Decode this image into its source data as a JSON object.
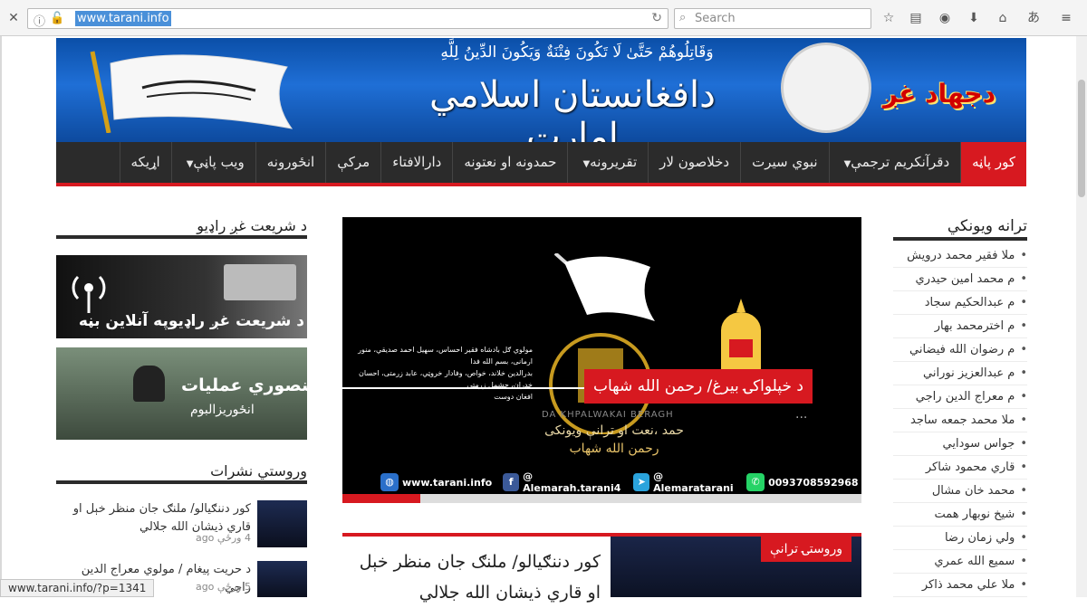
{
  "browser": {
    "url": "www.tarani.info",
    "search_placeholder": "Search",
    "status_url": "www.tarani.info/?p=1341"
  },
  "banner": {
    "verse": "وَقَاتِلُوهُمْ حَتَّىٰ لَا تَكُونَ فِتْنَةٌ وَيَكُونَ الدِّينُ لِلَّهِ",
    "title": "دافغانستان اسلامي امارت",
    "brand": "دجهاد غږ"
  },
  "nav": [
    {
      "label": "کور پاڼه",
      "active": true,
      "caret": false
    },
    {
      "label": "دقرآنکریم ترجمې",
      "active": false,
      "caret": true
    },
    {
      "label": "نبوي سيرت",
      "active": false,
      "caret": false
    },
    {
      "label": "دخلاصون لار",
      "active": false,
      "caret": false
    },
    {
      "label": "تقريرونه",
      "active": false,
      "caret": true
    },
    {
      "label": "حمدونه او نعتونه",
      "active": false,
      "caret": false
    },
    {
      "label": "دارالافتاء",
      "active": false,
      "caret": false
    },
    {
      "label": "مرکې",
      "active": false,
      "caret": false
    },
    {
      "label": "انځورونه",
      "active": false,
      "caret": false
    },
    {
      "label": "ويب پاڼې",
      "active": false,
      "caret": true
    },
    {
      "label": "اړيکه",
      "active": false,
      "caret": false
    }
  ],
  "right_sidebar": {
    "title": "ترانه ويونکي",
    "songs": [
      "ملا فقير محمد درويش",
      "م محمد امين حيدري",
      "م عبدالحکيم سجاد",
      "م اخترمحمد بهار",
      "م رضوان الله فيضاني",
      "م عبدالعزيز نوراني",
      "م معراج الدين راجي",
      "ملا محمد جمعه ساجد",
      "جواس سودايي",
      "قاري محمود شاکر",
      "محمد خان مشال",
      "شيخ نوبهار همت",
      "ولي زمان رضا",
      "سميع الله عمري",
      "ملا علي محمد ذاکر"
    ]
  },
  "slider": {
    "caption": "د خپلواکۍ بیرغ/ رحمن الله شهاب",
    "ellipsis": "...",
    "watermark": "DA KHPALWAKAI BERAGH",
    "subtitle_line1": "حمد ،نعت او ترانې ويونکی",
    "subtitle_line2": "رحمن الله شهاب",
    "contacts": [
      {
        "icon": "globe-icon",
        "text": "www.tarani.info"
      },
      {
        "icon": "facebook-icon",
        "text": "@ Alemarah.tarani4"
      },
      {
        "icon": "telegram-icon",
        "text": "@ Alemaratarani"
      },
      {
        "icon": "whatsapp-icon",
        "text": "0093708592968"
      }
    ]
  },
  "latest_song": {
    "tag": "وروستۍ ترانې",
    "title": "کور دننګيالو/ ملنګ جان منظر خېل او قاري ذيشان الله جلالي"
  },
  "left_sidebar": {
    "radio_title": "د شريعت غږ راډيو",
    "radio_banner_text": "د شريعت غږ راډيوپه آنلاين بڼه",
    "ops_title": "منصوري عمليات",
    "ops_sub": "انځوريزالبوم",
    "latest_title": "وروستي نشرات",
    "posts": [
      {
        "title": "کور دننګيالو/ ملنګ جان منظر خېل او قاري ذيشان الله جلالي",
        "time": "4 ورځې ago"
      },
      {
        "title": "د حريت پيغام / مولوي معراج الدين راجي",
        "time": "5 ورځې ago"
      }
    ]
  }
}
